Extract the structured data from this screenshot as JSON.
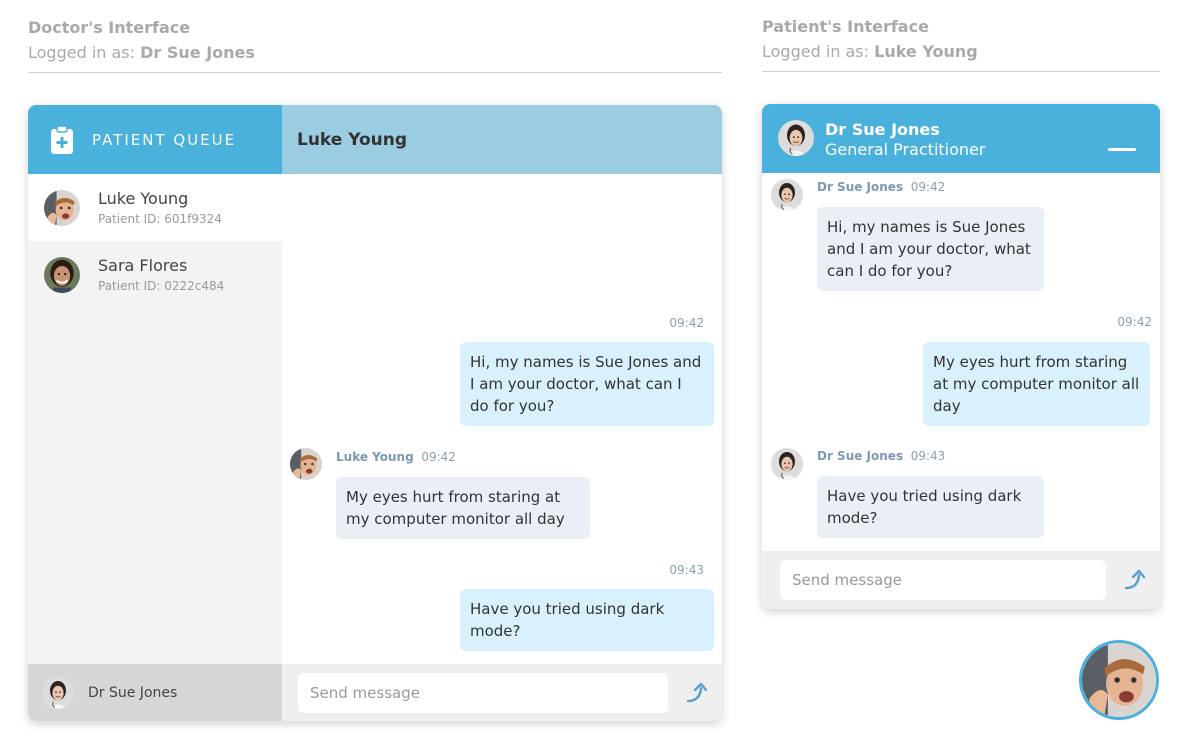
{
  "doctor_interface": {
    "title": "Doctor's Interface",
    "logged_in_label": "Logged in as:",
    "logged_in_user": "Dr Sue Jones",
    "queue": {
      "title": "PATIENT QUEUE",
      "icon": "medical-clipboard-icon",
      "patients": [
        {
          "name": "Luke Young",
          "id": "Patient ID: 601f9324",
          "active": true
        },
        {
          "name": "Sara Flores",
          "id": "Patient ID: 0222c484",
          "active": false
        }
      ],
      "footer_user": "Dr Sue Jones"
    },
    "chat": {
      "title": "Luke Young",
      "placeholder": "Send message",
      "messages": [
        {
          "time": "09:42",
          "text": "Hi, my names is Sue Jones and I am your doctor, what can I do for you?",
          "direction": "out"
        },
        {
          "sender": "Luke Young",
          "time": "09:42",
          "text": "My eyes hurt from staring at my computer monitor all day",
          "direction": "in"
        },
        {
          "time": "09:43",
          "text": "Have you tried using dark mode?",
          "direction": "out"
        }
      ]
    }
  },
  "patient_interface": {
    "title": "Patient's Interface",
    "logged_in_label": "Logged in as:",
    "logged_in_user": "Luke Young",
    "chat": {
      "doctor_name": "Dr Sue Jones",
      "doctor_role": "General Practitioner",
      "placeholder": "Send message",
      "messages": [
        {
          "sender": "Dr Sue Jones",
          "time": "09:42",
          "text": "Hi, my names is Sue Jones and I am your doctor, what can I do for you?",
          "direction": "in"
        },
        {
          "time": "09:42",
          "text": "My eyes hurt from staring at my computer monitor all day",
          "direction": "out"
        },
        {
          "sender": "Dr Sue Jones",
          "time": "09:43",
          "text": "Have you tried using dark mode?",
          "direction": "in"
        }
      ]
    }
  },
  "colors": {
    "primary": "#4ab1dc",
    "chat_header": "#9bcde2",
    "bubble_out": "#d8f1fc",
    "bubble_in": "#e9eff5"
  }
}
